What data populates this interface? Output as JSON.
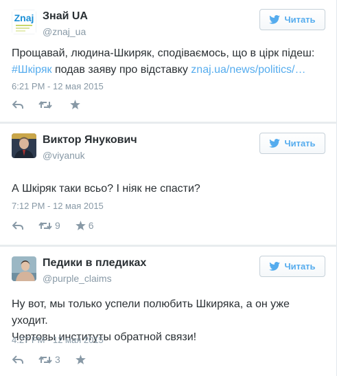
{
  "colors": {
    "link": "#55acee",
    "meta": "#8899a6",
    "text": "#292f33",
    "border": "#e1e8ed"
  },
  "follow_label": "Читать",
  "tweets": [
    {
      "name": "Знай UA",
      "handle": "@znaj_ua",
      "avatar_icon": "znaj-logo-icon",
      "avatar_text": "Znaj",
      "text_before": "Прощавай, людина-Шкиряк, сподіваємось, що в цірк підеш: ",
      "hashtag": "#Шкіряк",
      "text_middle": " подав заяву про відставку ",
      "link": "znaj.ua/news/politics/…",
      "date": "6:21 PM - 12 мая 2015",
      "retweets": "",
      "favorites": ""
    },
    {
      "name": "Виктор Янукович",
      "handle": "@viyanuk",
      "avatar_icon": "person-avatar-icon",
      "text": "А Шкіряк таки всьо? І ніяк не спасти?",
      "date": "7:12 PM - 12 мая 2015",
      "retweets": "9",
      "favorites": "6"
    },
    {
      "name": "Педики в пледиках",
      "handle": "@purple_claims",
      "avatar_icon": "person-avatar-icon",
      "text_line1": "Ну вот, мы только успели полюбить Шкиряка, а он уже уходит.",
      "text_line2": "Чертовы институты обратной связи!",
      "date": "4:27 PM - 12 мая 2015",
      "retweets": "3",
      "favorites": ""
    }
  ]
}
